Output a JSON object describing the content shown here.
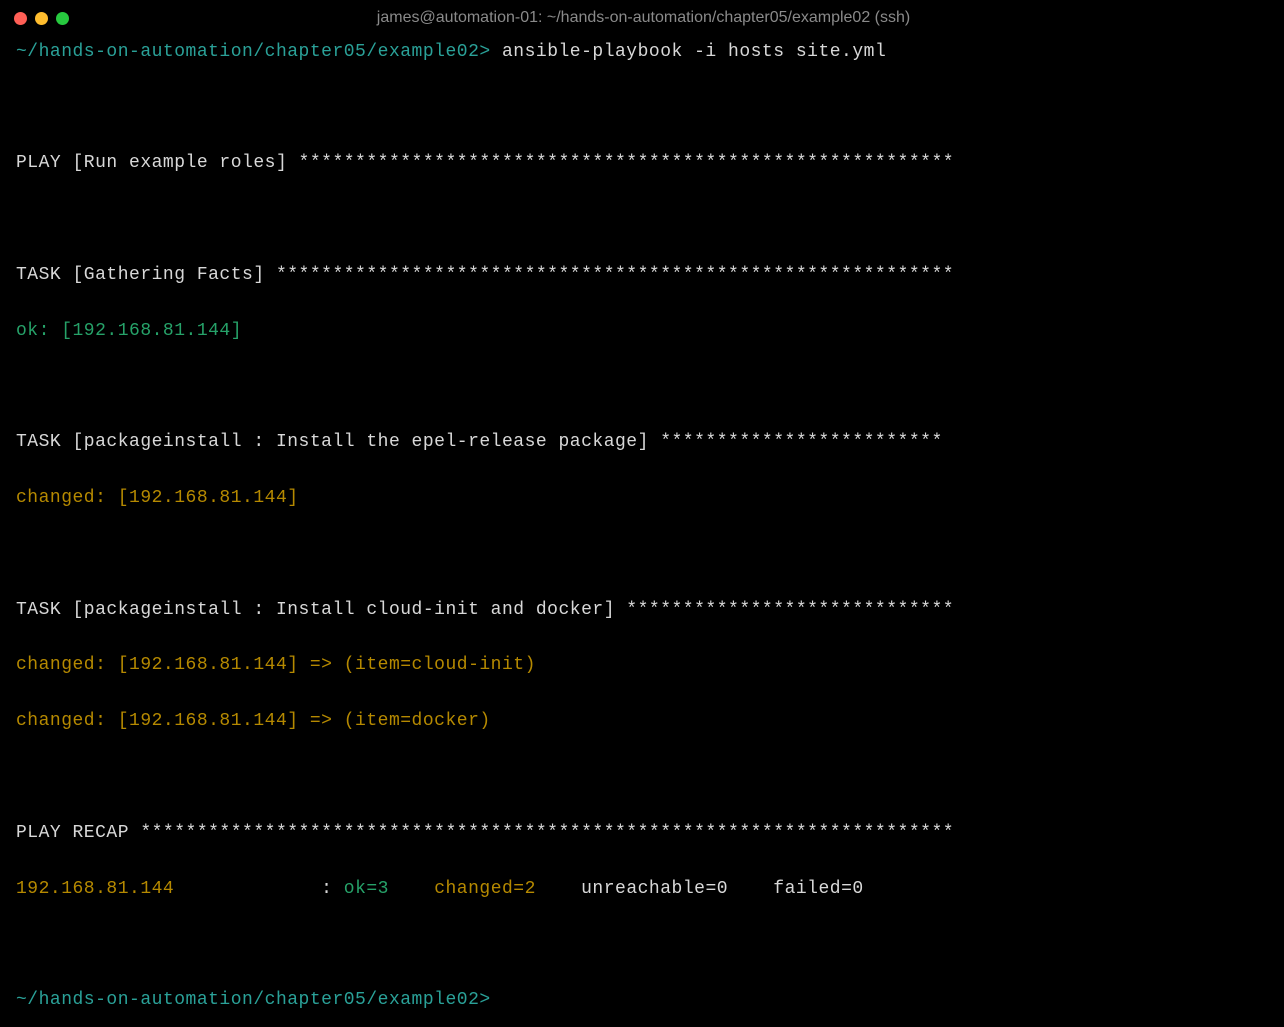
{
  "window": {
    "title": "james@automation-01: ~/hands-on-automation/chapter05/example02 (ssh)"
  },
  "prompt1": {
    "path": "~/hands-on-automation/chapter05/example02>",
    "command": " ansible-playbook -i hosts site.yml"
  },
  "play_header": "PLAY [Run example roles] **********************************************************",
  "task_gather": {
    "header": "TASK [Gathering Facts] ************************************************************",
    "ok": "ok: [192.168.81.144]"
  },
  "task_epel": {
    "header": "TASK [packageinstall : Install the epel-release package] *************************",
    "changed": "changed: [192.168.81.144]"
  },
  "task_cloud": {
    "header": "TASK [packageinstall : Install cloud-init and docker] *****************************",
    "item1": "changed: [192.168.81.144] => (item=cloud-init)",
    "item2": "changed: [192.168.81.144] => (item=docker)"
  },
  "recap": {
    "header": "PLAY RECAP ************************************************************************",
    "host": "192.168.81.144             ",
    "colon": ": ",
    "ok": "ok=3    ",
    "changed": "changed=2    ",
    "unreachable": "unreachable=0    ",
    "failed": "failed=0"
  },
  "prompt2": {
    "path": "~/hands-on-automation/chapter05/example02>"
  }
}
